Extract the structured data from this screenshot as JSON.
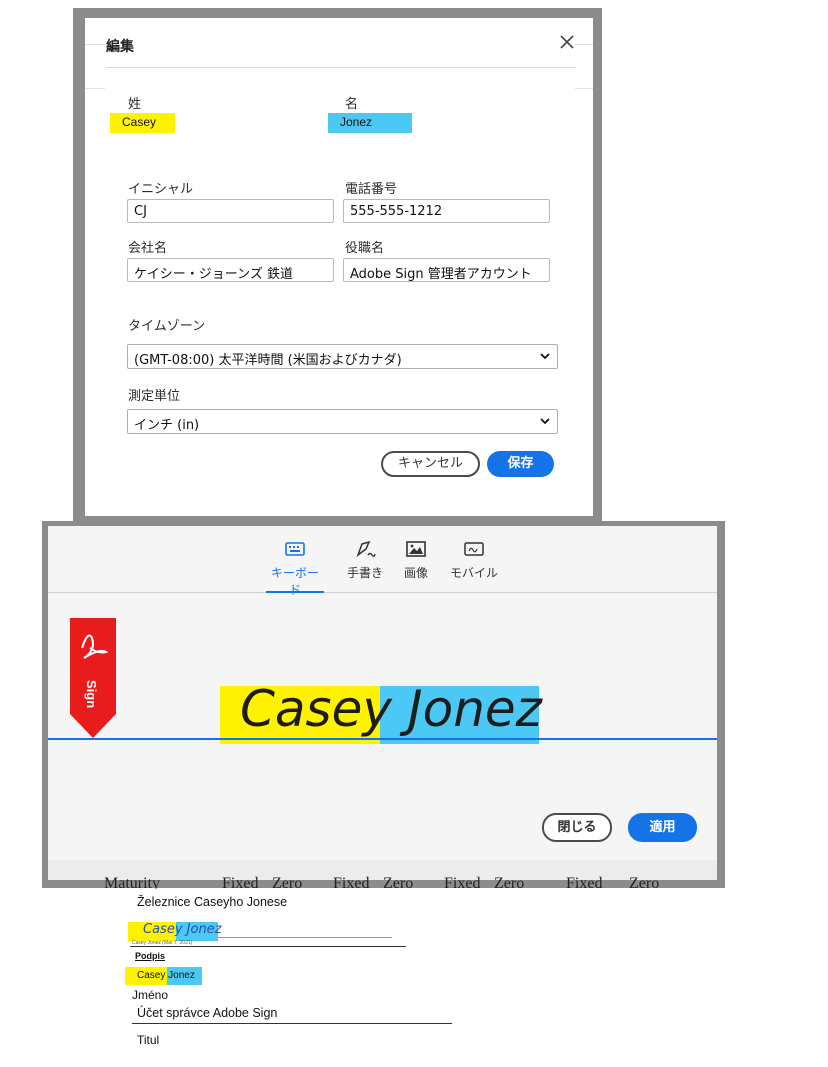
{
  "dialog": {
    "title": "編集",
    "close_icon": "close-icon",
    "last_name": {
      "label": "姓",
      "value": "Casey"
    },
    "first_name": {
      "label": "名",
      "value": "Jonez"
    },
    "initials": {
      "label": "イニシャル",
      "value": "CJ"
    },
    "phone": {
      "label": "電話番号",
      "value": "555-555-1212"
    },
    "company": {
      "label": "会社名",
      "value": "ケイシー・ジョーンズ 鉄道"
    },
    "job_title": {
      "label": "役職名",
      "value": "Adobe Sign 管理者アカウント"
    },
    "timezone": {
      "label": "タイムゾーン",
      "value": "(GMT-08:00) 太平洋時間 (米国およびカナダ)"
    },
    "units": {
      "label": "測定単位",
      "value": "インチ (in)"
    },
    "cancel_label": "キャンセル",
    "save_label": "保存",
    "highlight_colors": {
      "last_name": "#fff200",
      "first_name": "#4cc8f4"
    }
  },
  "signature_panel": {
    "tabs": [
      {
        "label": "キーボード",
        "icon": "keyboard-icon",
        "active": true
      },
      {
        "label": "手書き",
        "icon": "pen-icon",
        "active": false
      },
      {
        "label": "画像",
        "icon": "image-icon",
        "active": false
      },
      {
        "label": "モバイル",
        "icon": "mobile-icon",
        "active": false
      }
    ],
    "badge_text": "Sign",
    "signature_first": "Casey",
    "signature_last": "Jonez",
    "close_label": "閉じる",
    "apply_label": "適用",
    "accent_color": "#1473e6"
  },
  "document": {
    "bleed_words": [
      "Maturity",
      "Fixed",
      "Zero",
      "Fixed",
      "Zero",
      "Fixed",
      "Zero",
      "Fixed",
      "Zero"
    ],
    "company_line": "Železnice Caseyho Jonese",
    "signature_first": "Casey",
    "signature_last": "Jonez",
    "signature_caption": "Casey Jonez (Mar 7, 2021)",
    "signature_label": "Podpis",
    "name_first": "Casey",
    "name_last": "Jonez",
    "name_label": "Jméno",
    "title_value": "Účet správce Adobe Sign",
    "title_label": "Titul"
  }
}
